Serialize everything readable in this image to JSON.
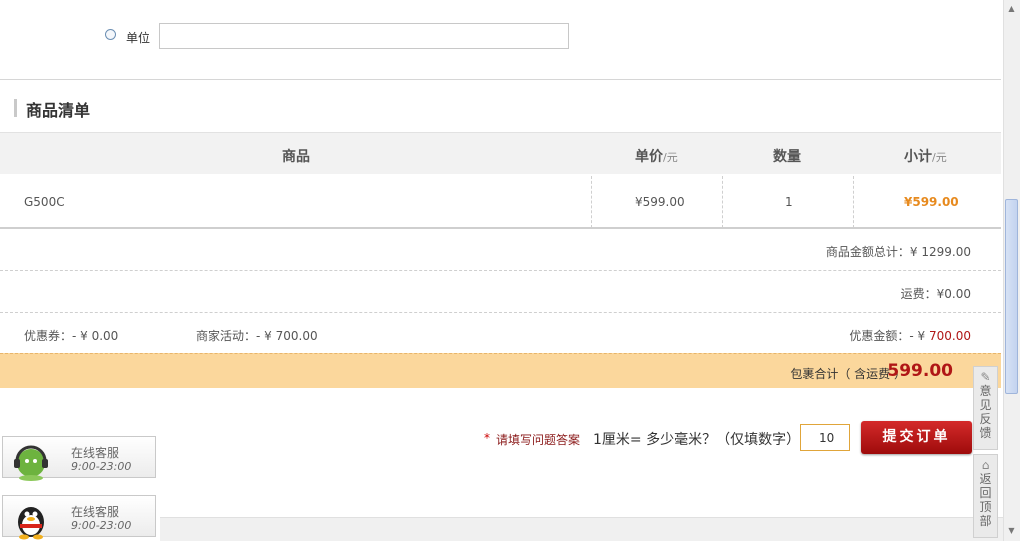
{
  "unit_option": {
    "label": "单位",
    "value": ""
  },
  "section": {
    "title": "商品清单"
  },
  "table": {
    "headers": {
      "product": "商品",
      "price": "单价",
      "price_unit": "/元",
      "qty": "数量",
      "subtotal": "小计",
      "subtotal_unit": "/元"
    },
    "rows": [
      {
        "name": "G500C",
        "price": "¥599.00",
        "qty": "1",
        "subtotal": "¥599.00"
      }
    ]
  },
  "summary": {
    "goods_total": "商品金额总计：¥ 1299.00",
    "shipping": "运费：¥0.00",
    "coupon": "优惠券：- ¥ 0.00",
    "activity": "商家活动：- ¥ 700.00",
    "discount_label": "优惠金额：- ¥ ",
    "discount_value": "700.00",
    "total_label": "包裹合计（ 含运费 ）",
    "total_amount": "599.00"
  },
  "question": {
    "star": "*",
    "label": "请填写问题答案",
    "text": "1厘米= 多少毫米？（仅填数字）",
    "answer": "10",
    "submit": "提交订单"
  },
  "service": [
    {
      "title": "在线客服",
      "time": "9:00-23:00",
      "icon": "headset-icon"
    },
    {
      "title": "在线客服",
      "time": "9:00-23:00",
      "icon": "qq-penguin-icon"
    }
  ],
  "tools": {
    "feedback": "意见反馈",
    "top": "返回顶部"
  },
  "colors": {
    "accent_red": "#b01616",
    "total_bar": "#fbd79c",
    "orange": "#e78a1e"
  }
}
